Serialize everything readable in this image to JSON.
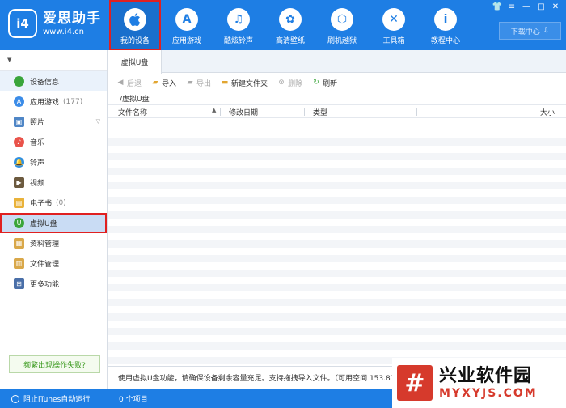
{
  "app": {
    "logo_badge": "i4",
    "name": "爱思助手",
    "url": "www.i4.cn"
  },
  "nav": [
    {
      "label": "我的设备",
      "icon": "",
      "active": true
    },
    {
      "label": "应用游戏",
      "icon": "A"
    },
    {
      "label": "酷炫铃声",
      "icon": "♫"
    },
    {
      "label": "高清壁纸",
      "icon": "✿"
    },
    {
      "label": "刷机越狱",
      "icon": "⬡"
    },
    {
      "label": "工具箱",
      "icon": "✕"
    },
    {
      "label": "教程中心",
      "icon": "i"
    }
  ],
  "window_controls": [
    "👕",
    "≡",
    "—",
    "□",
    "✕"
  ],
  "download_center": "下载中心",
  "sidebar": {
    "items": [
      {
        "label": "设备信息",
        "count": "",
        "icon_color": "#3aa53a",
        "icon_glyph": "i"
      },
      {
        "label": "应用游戏",
        "count": "(177)",
        "icon_color": "#3b8ce8",
        "icon_glyph": "A"
      },
      {
        "label": "照片",
        "count": "",
        "icon_color": "#4f86c6",
        "icon_glyph": "▣"
      },
      {
        "label": "音乐",
        "count": "",
        "icon_color": "#e9534a",
        "icon_glyph": "♪"
      },
      {
        "label": "铃声",
        "count": "",
        "icon_color": "#2f8fe0",
        "icon_glyph": "🔔"
      },
      {
        "label": "视频",
        "count": "",
        "icon_color": "#6c5a3f",
        "icon_glyph": "▶"
      },
      {
        "label": "电子书",
        "count": "(0)",
        "icon_color": "#e9b23a",
        "icon_glyph": "▤"
      },
      {
        "label": "虚拟U盘",
        "count": "",
        "icon_color": "#3aa53a",
        "icon_glyph": "U"
      },
      {
        "label": "资料管理",
        "count": "",
        "icon_color": "#d9a84a",
        "icon_glyph": "▦"
      },
      {
        "label": "文件管理",
        "count": "",
        "icon_color": "#d9a84a",
        "icon_glyph": "▥"
      },
      {
        "label": "更多功能",
        "count": "",
        "icon_color": "#4a6fa8",
        "icon_glyph": "⊞"
      }
    ],
    "help_link": "频繁出现操作失败?"
  },
  "tab": "虚拟U盘",
  "toolbar": {
    "back": "后退",
    "import": "导入",
    "export": "导出",
    "new_folder": "新建文件夹",
    "delete": "删除",
    "refresh": "刷新"
  },
  "path": "/虚拟U盘",
  "columns": {
    "name": "文件名称",
    "modified": "修改日期",
    "type": "类型",
    "size": "大小"
  },
  "info_text": "使用虚拟U盘功能，请确保设备剩余容量充足。支持拖拽导入文件。（可用空间 153.81 GB",
  "status": {
    "itunes": "阻止iTunes自动运行",
    "items": "0 个项目"
  },
  "watermark": {
    "glyph": "#",
    "cn": "兴业软件园",
    "en": "MYXYJS.COM"
  }
}
